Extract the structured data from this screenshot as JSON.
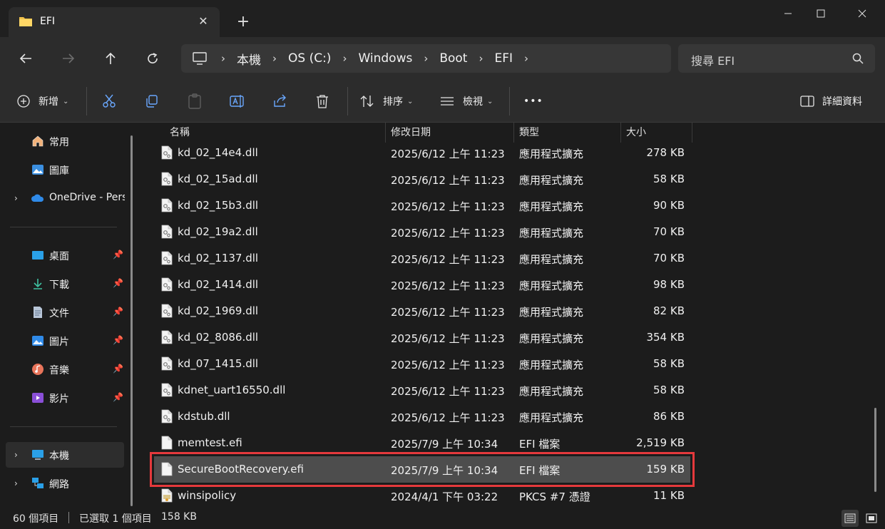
{
  "window": {
    "tab_title": "EFI",
    "tab_close": "✕",
    "new_tab": "+",
    "minimize": "—",
    "maximize": "☐",
    "close": "✕"
  },
  "address": {
    "breadcrumbs": [
      "本機",
      "OS (C:)",
      "Windows",
      "Boot",
      "EFI"
    ],
    "search_placeholder": "搜尋 EFI"
  },
  "commands": {
    "new": "新增",
    "sort": "排序",
    "view": "檢視",
    "more": "•••",
    "details": "詳細資料"
  },
  "sidebar": {
    "home": "常用",
    "gallery": "圖庫",
    "onedrive": "OneDrive - Personal",
    "desktop": "桌面",
    "downloads": "下載",
    "documents": "文件",
    "pictures": "圖片",
    "music": "音樂",
    "videos": "影片",
    "thispc": "本機",
    "network": "網路"
  },
  "columns": {
    "name": "名稱",
    "modified": "修改日期",
    "type": "類型",
    "size": "大小"
  },
  "files": [
    {
      "name": "kd_02_14e4.dll",
      "date": "2025/6/12 上午 11:23",
      "type": "應用程式擴充",
      "size": "278 KB",
      "icon": "dll-icon"
    },
    {
      "name": "kd_02_15ad.dll",
      "date": "2025/6/12 上午 11:23",
      "type": "應用程式擴充",
      "size": "58 KB",
      "icon": "dll-icon"
    },
    {
      "name": "kd_02_15b3.dll",
      "date": "2025/6/12 上午 11:23",
      "type": "應用程式擴充",
      "size": "90 KB",
      "icon": "dll-icon"
    },
    {
      "name": "kd_02_19a2.dll",
      "date": "2025/6/12 上午 11:23",
      "type": "應用程式擴充",
      "size": "70 KB",
      "icon": "dll-icon"
    },
    {
      "name": "kd_02_1137.dll",
      "date": "2025/6/12 上午 11:23",
      "type": "應用程式擴充",
      "size": "70 KB",
      "icon": "dll-icon"
    },
    {
      "name": "kd_02_1414.dll",
      "date": "2025/6/12 上午 11:23",
      "type": "應用程式擴充",
      "size": "98 KB",
      "icon": "dll-icon"
    },
    {
      "name": "kd_02_1969.dll",
      "date": "2025/6/12 上午 11:23",
      "type": "應用程式擴充",
      "size": "82 KB",
      "icon": "dll-icon"
    },
    {
      "name": "kd_02_8086.dll",
      "date": "2025/6/12 上午 11:23",
      "type": "應用程式擴充",
      "size": "354 KB",
      "icon": "dll-icon"
    },
    {
      "name": "kd_07_1415.dll",
      "date": "2025/6/12 上午 11:23",
      "type": "應用程式擴充",
      "size": "58 KB",
      "icon": "dll-icon"
    },
    {
      "name": "kdnet_uart16550.dll",
      "date": "2025/6/12 上午 11:23",
      "type": "應用程式擴充",
      "size": "58 KB",
      "icon": "dll-icon"
    },
    {
      "name": "kdstub.dll",
      "date": "2025/6/12 上午 11:23",
      "type": "應用程式擴充",
      "size": "86 KB",
      "icon": "dll-icon"
    },
    {
      "name": "memtest.efi",
      "date": "2025/7/9 上午 10:34",
      "type": "EFI 檔案",
      "size": "2,519 KB",
      "icon": "file-icon"
    },
    {
      "name": "SecureBootRecovery.efi",
      "date": "2025/7/9 上午 10:34",
      "type": "EFI 檔案",
      "size": "159 KB",
      "icon": "file-icon",
      "selected": true
    },
    {
      "name": "winsipolicy",
      "date": "2024/4/1 下午 03:22",
      "type": "PKCS #7 憑證",
      "size": "11 KB",
      "icon": "certificate-icon"
    }
  ],
  "status": {
    "count": "60 個項目",
    "selected": "已選取 1 個項目",
    "selected_size": "158 KB"
  }
}
